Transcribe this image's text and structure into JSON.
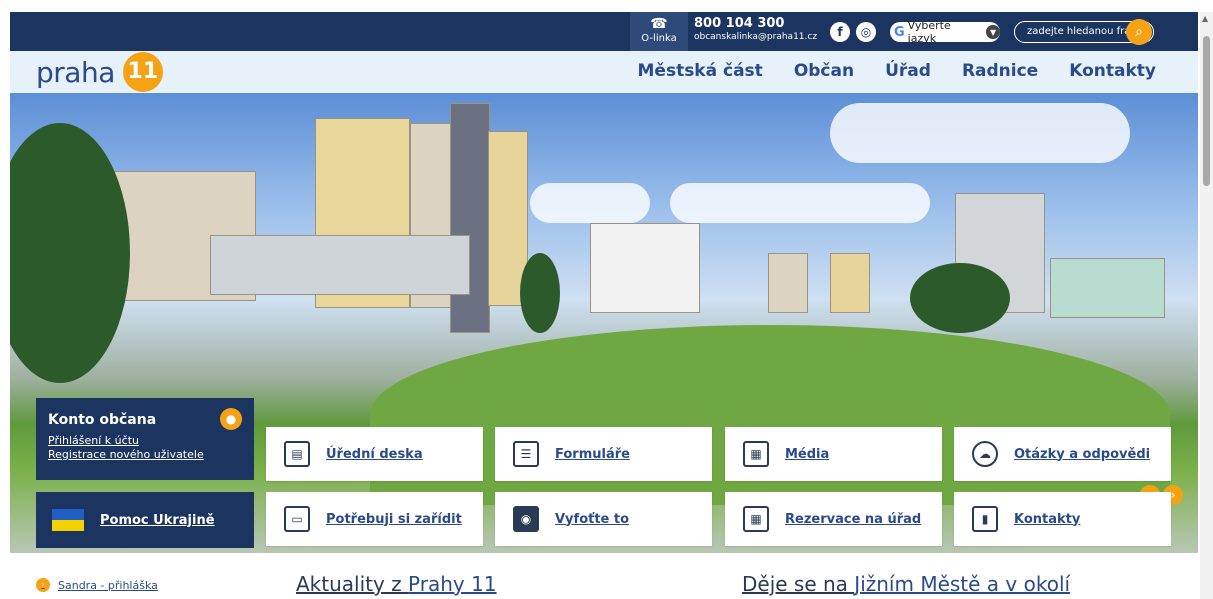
{
  "topbar": {
    "olinka_label": "O-linka",
    "phone": "800 104 300",
    "email": "obcanskalinka@praha11.cz",
    "language_label": "Vyberte jazyk",
    "search_placeholder": "zadejte hledanou frázi"
  },
  "header": {
    "logo_text": "praha",
    "logo_number": "11",
    "nav": [
      "Městská část",
      "Občan",
      "Úřad",
      "Radnice",
      "Kontakty"
    ]
  },
  "konto": {
    "title": "Konto občana",
    "login": "Přihlášení k účtu",
    "register": "Registrace nového uživatele"
  },
  "ukraine": {
    "label": "Pomoc Ukrajině"
  },
  "tiles": [
    {
      "label": "Úřední deska",
      "icon": "notice-board-icon"
    },
    {
      "label": "Formuláře",
      "icon": "clipboard-icon"
    },
    {
      "label": "Média",
      "icon": "newspaper-icon"
    },
    {
      "label": "Otázky a odpovědi",
      "icon": "chat-bubbles-icon"
    },
    {
      "label": "Potřebuji si zařídit",
      "icon": "id-card-icon"
    },
    {
      "label": "Vyfoťte to",
      "icon": "camera-icon"
    },
    {
      "label": "Rezervace na úřad",
      "icon": "calendar-clock-icon"
    },
    {
      "label": "Kontakty",
      "icon": "contact-card-icon"
    }
  ],
  "bottom": {
    "link": "Sandra - přihláška",
    "news_prefix": "Aktuality z ",
    "news_highlight": "Prahy 11",
    "events_prefix": "Děje se na ",
    "events_highlight": "Jižním Městě a v okolí"
  },
  "colors": {
    "primary": "#1c3560",
    "accent": "#f5a314",
    "link": "#2b4a8a"
  }
}
